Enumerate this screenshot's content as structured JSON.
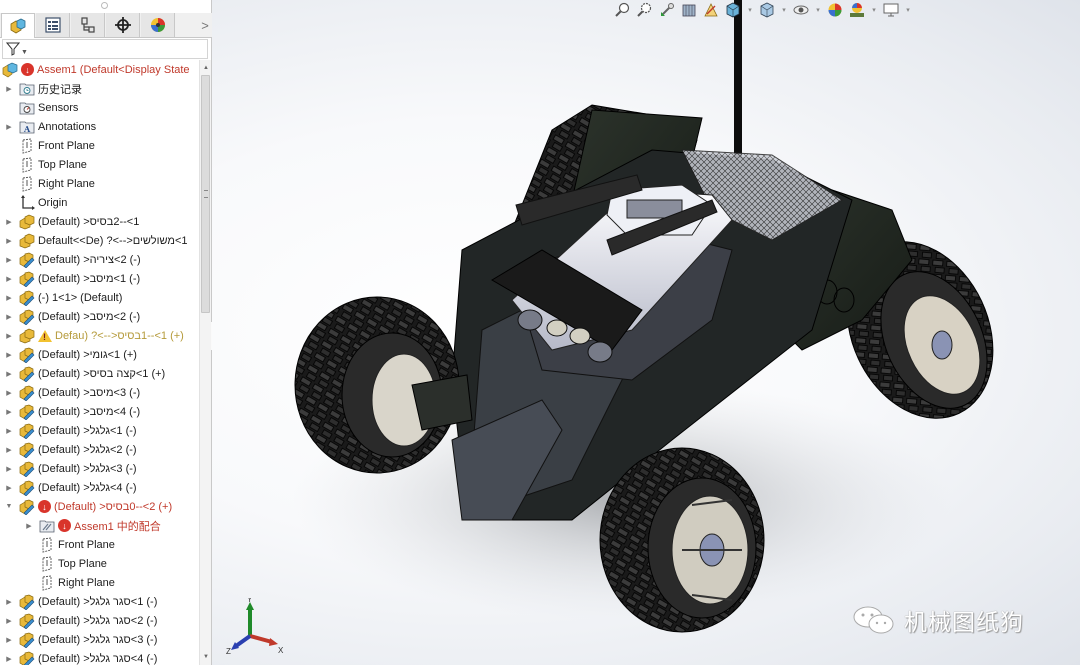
{
  "panel": {
    "tabs": [
      {
        "name": "featuremanager",
        "icon": "assembly-icon",
        "active": true
      },
      {
        "name": "propertymanager",
        "icon": "property-list-icon",
        "active": false
      },
      {
        "name": "configurationmanager",
        "icon": "configuration-icon",
        "active": false
      },
      {
        "name": "dimxpertmanager",
        "icon": "crosshair-icon",
        "active": false
      },
      {
        "name": "displaymanager",
        "icon": "appearance-sphere-icon",
        "active": false
      }
    ],
    "more_label": ">",
    "filter_icon": "filter-icon",
    "tree": [
      {
        "label": "Assem1  (Default<Display State",
        "icon": "assembly-icon",
        "status": "error",
        "expander": "none",
        "indent": 0
      },
      {
        "label": "历史记录",
        "icon": "history-folder-icon",
        "status": "",
        "expander": "collapsed",
        "indent": 1
      },
      {
        "label": "Sensors",
        "icon": "sensors-folder-icon",
        "status": "",
        "expander": "none",
        "indent": 1
      },
      {
        "label": "Annotations",
        "icon": "annotations-folder-icon",
        "status": "",
        "expander": "collapsed",
        "indent": 1
      },
      {
        "label": "Front Plane",
        "icon": "plane-icon",
        "status": "",
        "expander": "none",
        "indent": 1
      },
      {
        "label": "Top Plane",
        "icon": "plane-icon",
        "status": "",
        "expander": "none",
        "indent": 1
      },
      {
        "label": "Right Plane",
        "icon": "plane-icon",
        "status": "",
        "expander": "none",
        "indent": 1
      },
      {
        "label": "Origin",
        "icon": "origin-icon",
        "status": "",
        "expander": "none",
        "indent": 1
      },
      {
        "label": "1>--2בסיס< (Default)",
        "icon": "subassembly-icon",
        "status": "",
        "expander": "collapsed",
        "indent": 1
      },
      {
        "label": "1>משולשים<-->? (Default<<De",
        "icon": "subassembly-icon",
        "status": "",
        "expander": "collapsed",
        "indent": 1
      },
      {
        "label": "(-) 2>ציריה< (Default)",
        "icon": "part-icon",
        "status": "",
        "expander": "collapsed",
        "indent": 1
      },
      {
        "label": "(-) 1>מיסב< (Default)",
        "icon": "part-icon",
        "status": "",
        "expander": "collapsed",
        "indent": 1
      },
      {
        "label": "(-) 1<1> (Default)",
        "icon": "part-icon",
        "status": "",
        "expander": "collapsed",
        "indent": 1
      },
      {
        "label": "(-) 2>מיסב< (Default)",
        "icon": "part-icon",
        "status": "",
        "expander": "collapsed",
        "indent": 1
      },
      {
        "label": "(+) 1>--1בסיס<-->? (Defau",
        "icon": "subassembly-icon",
        "status": "warning",
        "expander": "collapsed",
        "indent": 1
      },
      {
        "label": "(+) 1>גומי< (Default)",
        "icon": "part-icon",
        "status": "",
        "expander": "collapsed",
        "indent": 1
      },
      {
        "label": "(+) 1>קצה בסיס< (Default)",
        "icon": "part-icon",
        "status": "",
        "expander": "collapsed",
        "indent": 1
      },
      {
        "label": "(-) 3>מיסב< (Default)",
        "icon": "part-icon",
        "status": "",
        "expander": "collapsed",
        "indent": 1
      },
      {
        "label": "(-) 4>מיסב< (Default)",
        "icon": "part-icon",
        "status": "",
        "expander": "collapsed",
        "indent": 1
      },
      {
        "label": "(-) 1>גלגל< (Default)",
        "icon": "part-icon",
        "status": "",
        "expander": "collapsed",
        "indent": 1
      },
      {
        "label": "(-) 2>גלגל< (Default)",
        "icon": "part-icon",
        "status": "",
        "expander": "collapsed",
        "indent": 1
      },
      {
        "label": "(-) 3>גלגל< (Default)",
        "icon": "part-icon",
        "status": "",
        "expander": "collapsed",
        "indent": 1
      },
      {
        "label": "(-) 4>גלגל< (Default)",
        "icon": "part-icon",
        "status": "",
        "expander": "collapsed",
        "indent": 1
      },
      {
        "label": "(+) 2>--0בסיס< (Default)",
        "icon": "part-icon",
        "status": "error",
        "expander": "expanded",
        "indent": 1
      },
      {
        "label": "Assem1 中的配合",
        "icon": "mates-folder-icon",
        "status": "error",
        "expander": "collapsed",
        "indent": 2
      },
      {
        "label": "Front Plane",
        "icon": "plane-icon",
        "status": "",
        "expander": "none",
        "indent": 2
      },
      {
        "label": "Top Plane",
        "icon": "plane-icon",
        "status": "",
        "expander": "none",
        "indent": 2
      },
      {
        "label": "Right Plane",
        "icon": "plane-icon",
        "status": "",
        "expander": "none",
        "indent": 2
      },
      {
        "label": "(-) 1>סגר גלגל< (Default)",
        "icon": "part-icon",
        "status": "",
        "expander": "collapsed",
        "indent": 1
      },
      {
        "label": "(-) 2>סגר גלגל< (Default)",
        "icon": "part-icon",
        "status": "",
        "expander": "collapsed",
        "indent": 1
      },
      {
        "label": "(-) 3>סגר גלגל< (Default)",
        "icon": "part-icon",
        "status": "",
        "expander": "collapsed",
        "indent": 1
      },
      {
        "label": "(-) 4>סגר גלגל< (Default)",
        "icon": "part-icon",
        "status": "",
        "expander": "collapsed",
        "indent": 1
      }
    ]
  },
  "headsup_toolbar": [
    {
      "icon": "zoom-to-fit-icon",
      "dropdown": false
    },
    {
      "icon": "zoom-to-area-icon",
      "dropdown": false
    },
    {
      "icon": "previous-view-icon",
      "dropdown": false
    },
    {
      "icon": "section-view-icon",
      "dropdown": false
    },
    {
      "icon": "dynamic-annotation-icon",
      "dropdown": false
    },
    {
      "icon": "view-orientation-icon",
      "dropdown": true
    },
    {
      "icon": "display-style-icon",
      "dropdown": true
    },
    {
      "icon": "hide-show-items-icon",
      "dropdown": true
    },
    {
      "icon": "edit-appearance-icon",
      "dropdown": false
    },
    {
      "icon": "apply-scene-icon",
      "dropdown": true
    },
    {
      "icon": "view-settings-icon",
      "dropdown": true
    }
  ],
  "triad": {
    "x_label": "X",
    "y_label": "Y",
    "z_label": "Z"
  },
  "watermark": {
    "icon": "wechat-icon",
    "text": "机械图纸狗"
  },
  "colors": {
    "error": "#d9342b",
    "warning": "#f2c230",
    "error_text": "#c0392b",
    "warning_text": "#b59a3a"
  }
}
